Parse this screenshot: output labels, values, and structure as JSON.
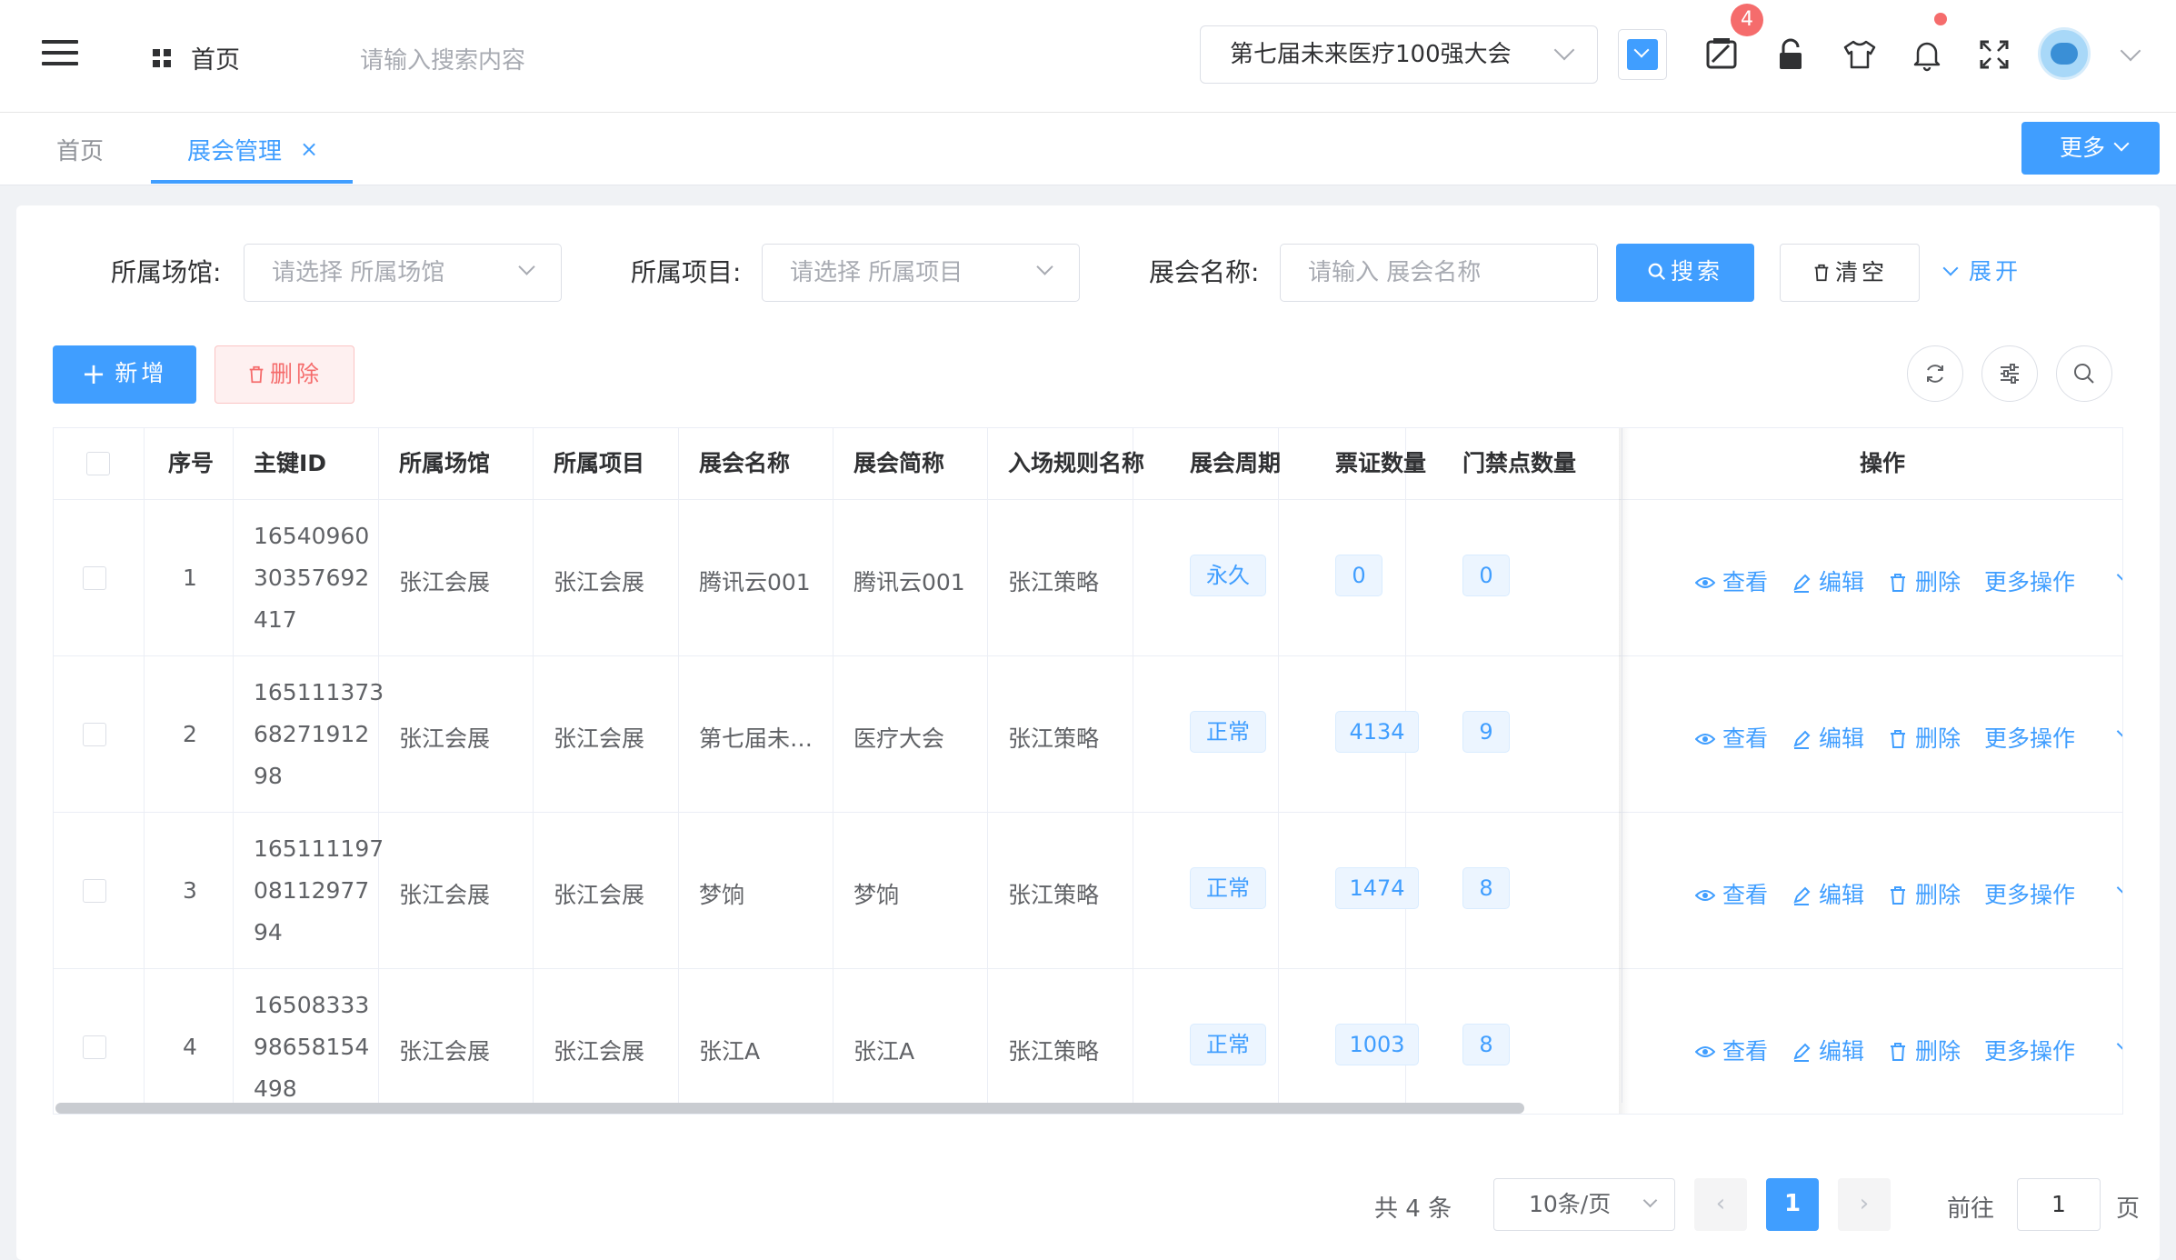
{
  "header": {
    "home": "首页",
    "search_placeholder": "请输入搜索内容",
    "conference": "第七届未来医疗100强大会",
    "theme_color": "#409eff",
    "badge_count": "4",
    "icons": [
      "menu-icon",
      "grid-icon",
      "chevron-down-icon",
      "print-icon",
      "lock-icon",
      "shirt-icon",
      "bell-icon",
      "fullscreen-icon",
      "avatar",
      "chevron-down-icon"
    ]
  },
  "tabs": {
    "home": "首页",
    "active": "展会管理",
    "close": "×",
    "more": "更多"
  },
  "filters": {
    "venue_label": "所属场馆:",
    "venue_placeholder": "请选择 所属场馆",
    "project_label": "所属项目:",
    "project_placeholder": "请选择 所属项目",
    "name_label": "展会名称:",
    "name_placeholder": "请输入 展会名称",
    "search": "搜索",
    "clear": "清空",
    "expand": "展开"
  },
  "toolbar": {
    "add": "新增",
    "delete": "删除"
  },
  "table": {
    "columns": [
      "序号",
      "主键ID",
      "所属场馆",
      "所属项目",
      "展会名称",
      "展会简称",
      "入场规则名称",
      "展会周期",
      "票证数量",
      "门禁点数量",
      "操作"
    ],
    "rows": [
      {
        "no": "1",
        "id": [
          "16540960",
          "30357692",
          "417"
        ],
        "venue": "张江会展",
        "project": "张江会展",
        "name": "腾讯云001",
        "short": "腾讯云001",
        "rule": "张江策略",
        "cycle": "永久",
        "tickets": "0",
        "gates": "0"
      },
      {
        "no": "2",
        "id": [
          "165111373",
          "68271912",
          "98"
        ],
        "venue": "张江会展",
        "project": "张江会展",
        "name": "第七届未…",
        "short": "医疗大会",
        "rule": "张江策略",
        "cycle": "正常",
        "tickets": "4134",
        "gates": "9"
      },
      {
        "no": "3",
        "id": [
          "165111197",
          "08112977",
          "94"
        ],
        "venue": "张江会展",
        "project": "张江会展",
        "name": "梦饷",
        "short": "梦饷",
        "rule": "张江策略",
        "cycle": "正常",
        "tickets": "1474",
        "gates": "8"
      },
      {
        "no": "4",
        "id": [
          "16508333",
          "98658154",
          "498"
        ],
        "venue": "张江会展",
        "project": "张江会展",
        "name": "张江A",
        "short": "张江A",
        "rule": "张江策略",
        "cycle": "正常",
        "tickets": "1003",
        "gates": "8"
      }
    ],
    "ops": {
      "view": "查看",
      "edit": "编辑",
      "delete": "删除",
      "more": "更多操作"
    }
  },
  "pagination": {
    "total": "共 4 条",
    "page_size": "10条/页",
    "current": "1",
    "goto": "前往",
    "goto_value": "1",
    "page_suffix": "页"
  }
}
